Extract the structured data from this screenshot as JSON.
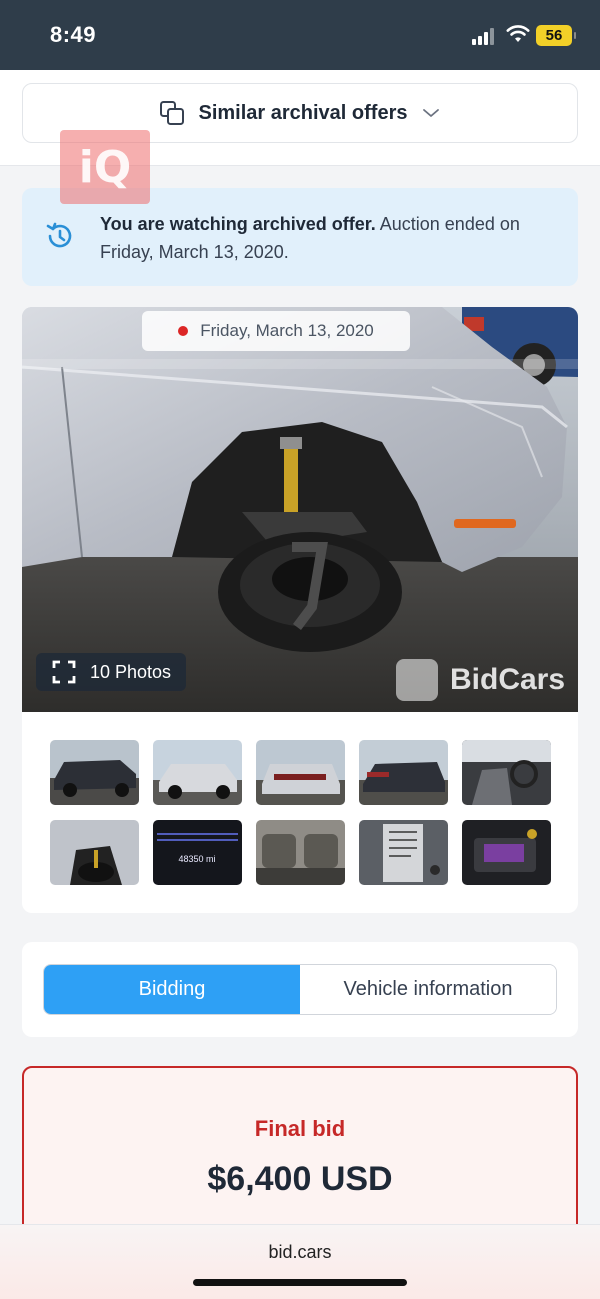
{
  "status_bar": {
    "time": "8:49",
    "battery": "56",
    "icons": [
      "signal-icon",
      "wifi-icon",
      "battery-icon"
    ]
  },
  "similar_offers": {
    "label": "Similar archival offers",
    "icon": "copy-icon",
    "chevron": "chevron-down-icon"
  },
  "watermark": {
    "text": "iQ"
  },
  "notice": {
    "icon": "history-icon",
    "bold": "You are watching archived offer.",
    "rest": " Auction ended on Friday, March 13, 2020.",
    "accent": "#2a8fd6"
  },
  "gallery": {
    "date": "Friday, March 13, 2020",
    "photos_count": "10 Photos",
    "brand_watermark": "BidCars",
    "thumbnails": [
      "front-left-view",
      "front-view",
      "rear-view",
      "rear-left-view",
      "interior-front",
      "wheel-damage",
      "odometer",
      "rear-seats",
      "door-label",
      "engine-bay"
    ],
    "odometer_text": "48350 mi"
  },
  "tabs": {
    "items": [
      {
        "label": "Bidding",
        "active": true
      },
      {
        "label": "Vehicle information",
        "active": false
      }
    ],
    "accent": "#2ea0f5"
  },
  "final_bid": {
    "label": "Final bid",
    "value": "$6,400 USD",
    "accent": "#c62828"
  },
  "browser": {
    "url": "bid.cars"
  }
}
